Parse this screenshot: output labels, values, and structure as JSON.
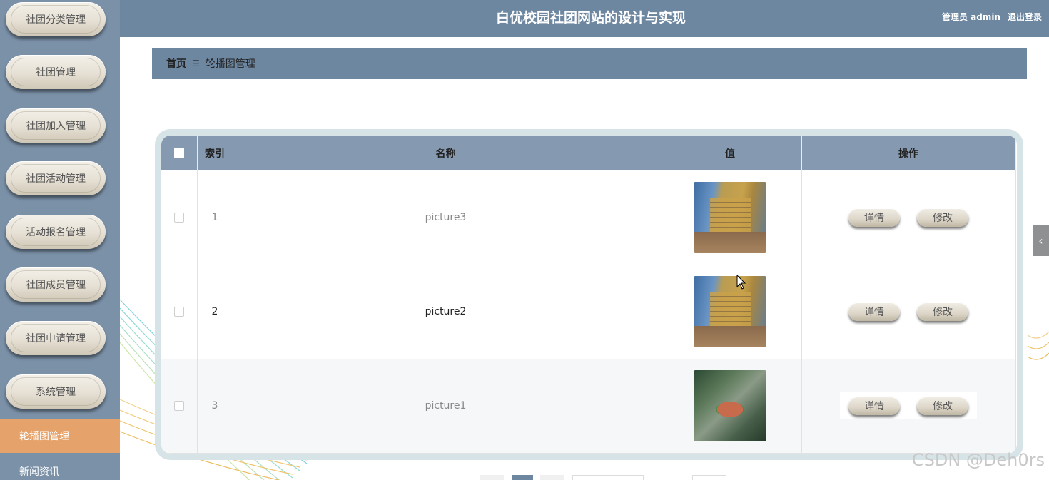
{
  "app": {
    "title": "白优校园社团网站的设计与实现",
    "user_label": "管理员 admin",
    "logout_label": "退出登录"
  },
  "sidebar": {
    "items": [
      {
        "label": "社团分类管理"
      },
      {
        "label": "社团管理"
      },
      {
        "label": "社团加入管理"
      },
      {
        "label": "社团活动管理"
      },
      {
        "label": "活动报名管理"
      },
      {
        "label": "社团成员管理"
      },
      {
        "label": "社团申请管理"
      },
      {
        "label": "系统管理"
      }
    ],
    "submenu": [
      {
        "label": "轮播图管理",
        "active": true
      },
      {
        "label": "新闻资讯",
        "active": false
      }
    ]
  },
  "breadcrumb": {
    "home": "首页",
    "separator_icon": "menu-icon",
    "current": "轮播图管理"
  },
  "table": {
    "headers": {
      "index": "索引",
      "name": "名称",
      "value": "值",
      "actions": "操作"
    },
    "rows": [
      {
        "index": "1",
        "name": "picture3",
        "image": "building-photo",
        "detail": "详情",
        "edit": "修改"
      },
      {
        "index": "2",
        "name": "picture2",
        "image": "building-photo",
        "detail": "详情",
        "edit": "修改"
      },
      {
        "index": "3",
        "name": "picture1",
        "image": "aerial-campus-photo",
        "detail": "详情",
        "edit": "修改"
      }
    ]
  },
  "watermark": "CSDN @Deh0rs",
  "colors": {
    "sidebar_bg": "#7b91a8",
    "header_bg": "#6e87a1",
    "active_menu": "#e5a36b",
    "table_header": "#8599b0",
    "panel_border": "#d6e3e7"
  }
}
